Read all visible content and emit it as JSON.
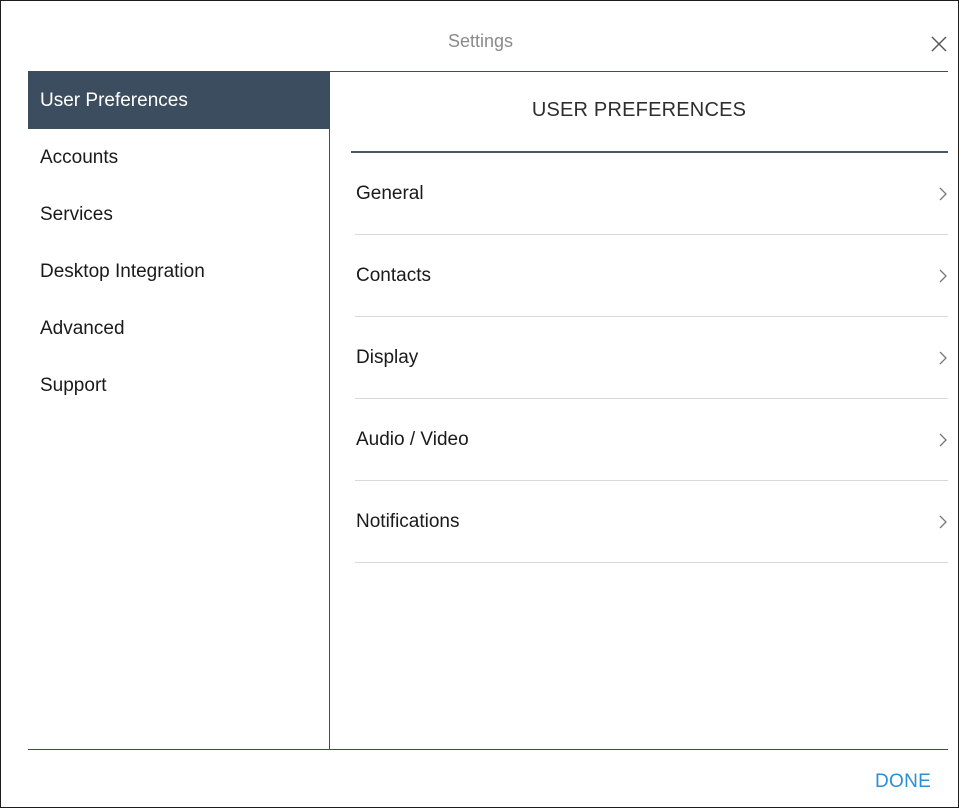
{
  "dialog": {
    "title": "Settings",
    "close_icon": "close-icon",
    "done_label": "DONE"
  },
  "sidebar": {
    "items": [
      {
        "label": "User Preferences",
        "selected": true
      },
      {
        "label": "Accounts",
        "selected": false
      },
      {
        "label": "Services",
        "selected": false
      },
      {
        "label": "Desktop Integration",
        "selected": false
      },
      {
        "label": "Advanced",
        "selected": false
      },
      {
        "label": "Support",
        "selected": false
      }
    ]
  },
  "main": {
    "heading": "USER PREFERENCES",
    "items": [
      {
        "label": "General",
        "icon": "chevron-right-icon"
      },
      {
        "label": "Contacts",
        "icon": "chevron-right-icon"
      },
      {
        "label": "Display",
        "icon": "chevron-right-icon"
      },
      {
        "label": "Audio / Video",
        "icon": "chevron-right-icon"
      },
      {
        "label": "Notifications",
        "icon": "chevron-right-icon"
      }
    ]
  },
  "colors": {
    "sidebar_selected_bg": "#3b4d5e",
    "accent": "#2a8fd6",
    "title_text": "#8a8a8a"
  }
}
